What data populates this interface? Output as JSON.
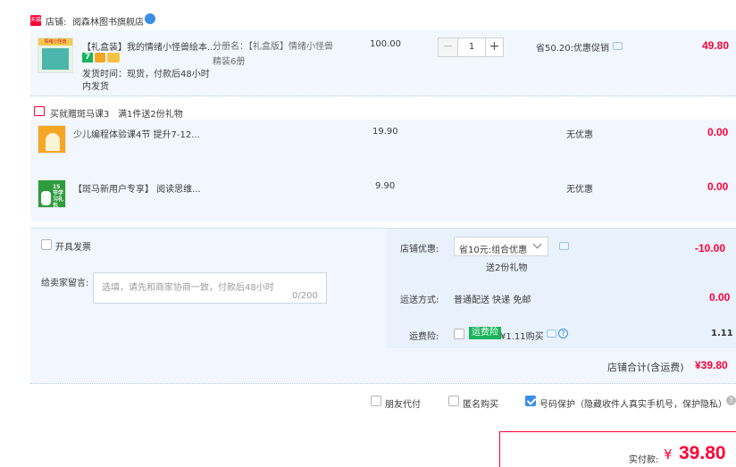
{
  "shop": {
    "prefix": "店铺:",
    "name": "阅森林图书旗舰店",
    "badge": "天猫"
  },
  "main_item": {
    "title": "【礼盒装】我的情绪小怪兽绘本...",
    "ship_line1": "发货时间：现货，付款后48小时",
    "ship_line2": "内发货",
    "spec": "分册名：【礼盒版】情绪小怪兽精装6册",
    "price": "100.00",
    "qty": "1",
    "promo": "省50.20:优惠促销",
    "subtotal": "49.80",
    "thumb_text": "情绪小怪兽"
  },
  "gift_header": {
    "title": "买就赠斑马课3",
    "desc": "满1件送2份礼物"
  },
  "gifts": [
    {
      "title": "少儿编程体验课4节 提升7-12...",
      "price": "19.90",
      "promo": "无优惠",
      "subtotal": "0.00"
    },
    {
      "title": "【斑马新用户专享】 阅读思维...",
      "price": "9.90",
      "promo": "无优惠",
      "subtotal": "0.00",
      "thumb_text": "15节学习礼包"
    }
  ],
  "invoice": {
    "label": "开具发票"
  },
  "message": {
    "label": "给卖家留言:",
    "placeholder": "选填，请先和商家协商一致，付款后48小时",
    "counter": "0/200"
  },
  "coupon": {
    "label": "店铺优惠:",
    "selected": "省10元:组合优惠",
    "sub": "送2份礼物",
    "amount": "-10.00"
  },
  "shipping": {
    "label": "运送方式:",
    "value": "普通配送 快递 免邮",
    "amount": "0.00"
  },
  "insurance": {
    "label": "运费险:",
    "tag": "运费险",
    "text": "¥1.11购买",
    "amount": "1.11"
  },
  "shop_total": {
    "label": "店铺合计(含运费)",
    "amount": "¥39.80"
  },
  "options": {
    "friend_pay": "朋友代付",
    "anonymous": "匿名购买",
    "privacy": "号码保护（隐藏收件人真实手机号，保护隐私）"
  },
  "pay": {
    "label": "实付款:",
    "currency": "¥",
    "amount": "39.80"
  },
  "colors": {
    "accent_red": "#ff0036",
    "panel_blue": "#f2f7ff",
    "link_blue": "#3a8ee6",
    "insurance_green": "#18b45a"
  }
}
